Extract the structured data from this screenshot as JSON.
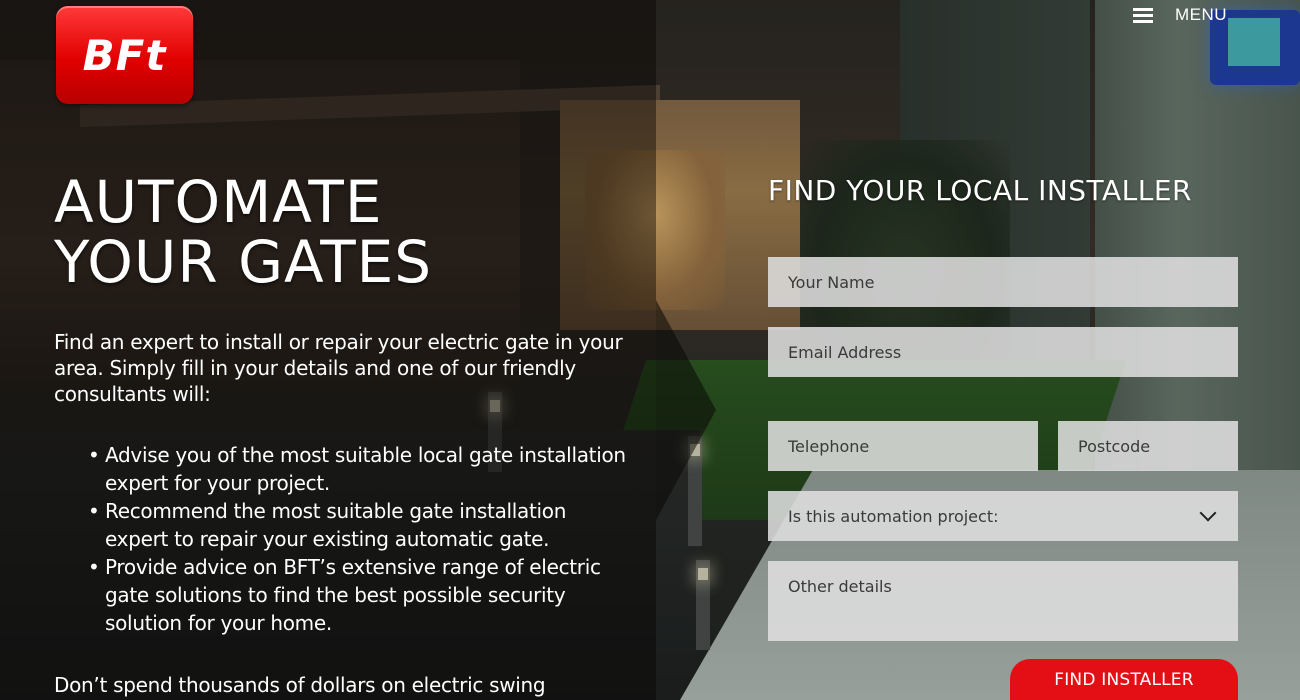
{
  "brand": {
    "logo_text": "BFt",
    "accent_color": "#e30f14"
  },
  "nav": {
    "menu_label": "MENU",
    "menu_icon": "hamburger-icon"
  },
  "hero": {
    "headline_line1": "AUTOMATE",
    "headline_line2": "YOUR GATES",
    "intro": "Find an expert to install or repair your electric gate in your area. Simply fill in your details and one of our friendly consultants will:",
    "bullets": [
      "Advise you of the most suitable local gate installation expert for your project.",
      "Recommend the most suitable gate installation expert to repair your existing automatic gate.",
      "Provide advice on BFT’s extensive range of electric gate solutions to find the best possible security solution for your home."
    ],
    "footer_text": "Don’t spend thousands of dollars on electric swing"
  },
  "form": {
    "title": "FIND YOUR LOCAL INSTALLER",
    "name_placeholder": "Your Name",
    "email_placeholder": "Email Address",
    "phone_placeholder": "Telephone",
    "postcode_placeholder": "Postcode",
    "project_select": "Is this automation project:",
    "details_placeholder": "Other details",
    "submit_label": "FIND INSTALLER"
  }
}
